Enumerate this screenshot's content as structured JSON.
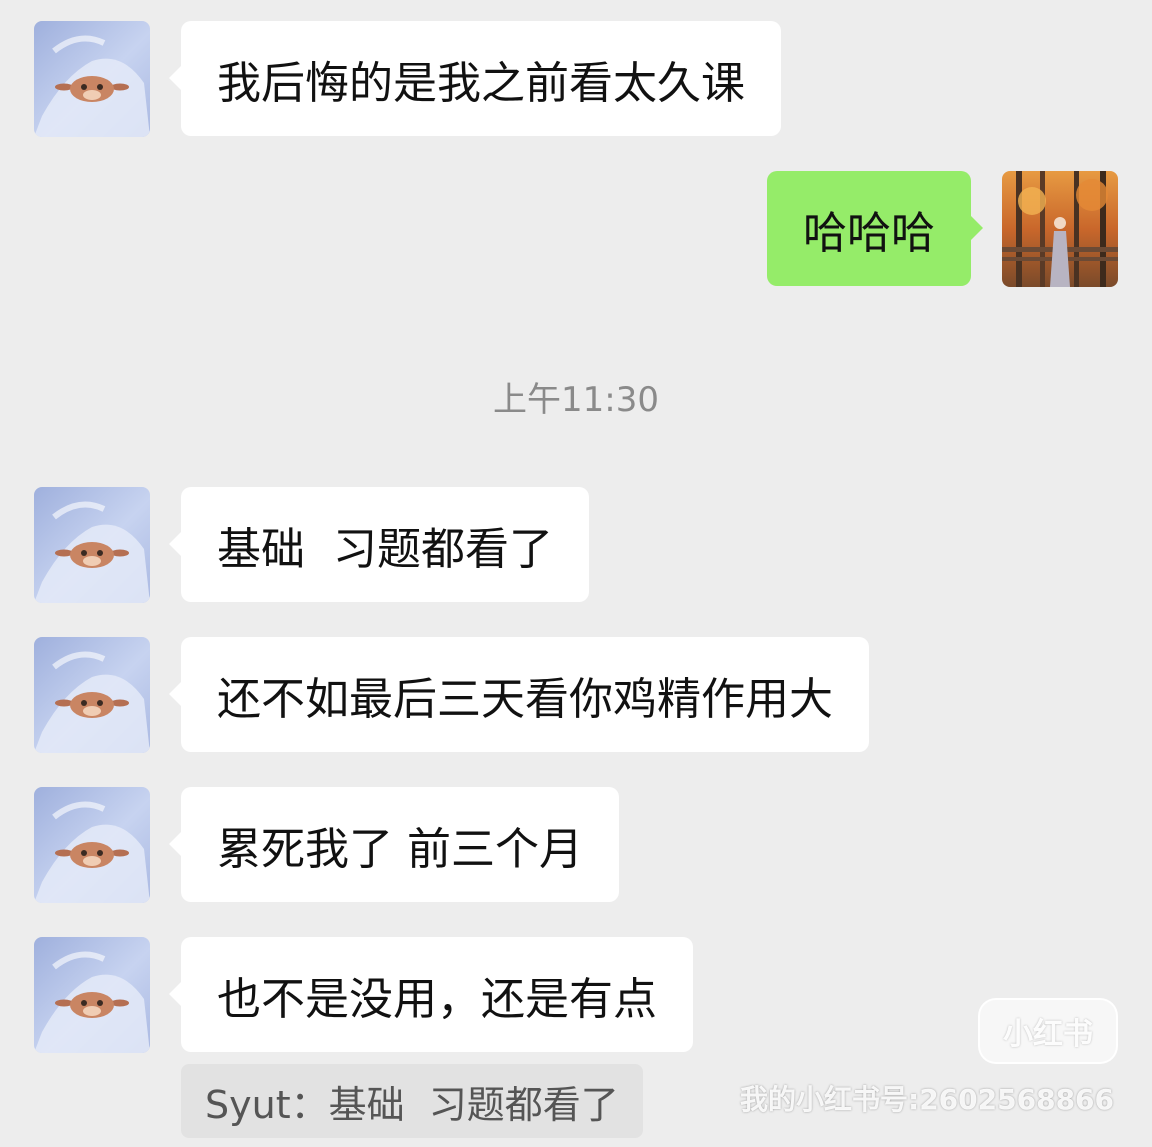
{
  "messages": [
    {
      "side": "left",
      "text": "我后悔的是我之前看太久课"
    },
    {
      "side": "right",
      "text": "哈哈哈"
    },
    {
      "side": "left",
      "text": "基础  习题都看了"
    },
    {
      "side": "left",
      "text": "还不如最后三天看你鸡精作用大"
    },
    {
      "side": "left",
      "text": "累死我了 前三个月"
    },
    {
      "side": "left",
      "text": "也不是没用，还是有点"
    }
  ],
  "timestamp": "上午11:30",
  "quote": "Syut：基础  习题都看了",
  "watermark": {
    "badge": "小红书",
    "id": "我的小红书号:2602568866"
  },
  "colors": {
    "background": "#ededed",
    "bubble_left": "#ffffff",
    "bubble_right": "#95ec69"
  },
  "icons": {
    "contact_avatar": "cartoon-deer-avatar",
    "my_avatar": "autumn-forest-photo-avatar"
  }
}
